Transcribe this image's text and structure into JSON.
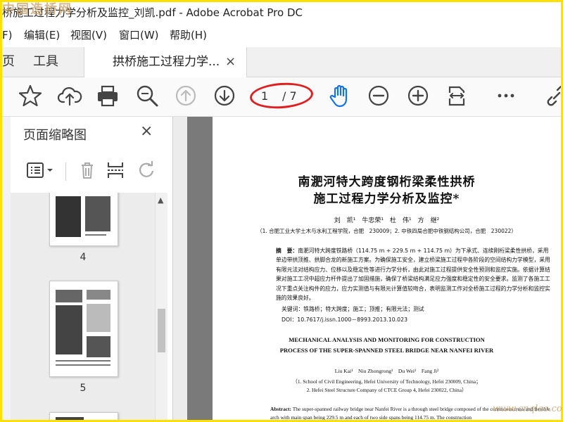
{
  "watermark": {
    "top": "中国造桥网",
    "bottom": "www.cnqlao.com"
  },
  "window": {
    "title": "桥施工过程力学分析及监控_刘凯.pdf - Adobe Acrobat Pro DC"
  },
  "menu": [
    {
      "label": "F)"
    },
    {
      "label": "编辑(E)"
    },
    {
      "label": "视图(V)"
    },
    {
      "label": "窗口(W)"
    },
    {
      "label": "帮助(H)"
    }
  ],
  "tabs": {
    "home_partial": "页",
    "tools": "工具",
    "document": "拱桥施工过程力学...",
    "close": "×"
  },
  "toolbar": {
    "page_current": "1",
    "page_total": "/ 7",
    "icons": [
      "star-icon",
      "cloud-upload-icon",
      "print-icon",
      "zoom-search-icon",
      "page-up-icon",
      "page-down-icon",
      "hand-tool-icon",
      "zoom-out-icon",
      "zoom-in-icon",
      "fit-page-icon",
      "more-icon",
      "link-icon"
    ],
    "accent": "#1473e6",
    "annotation_color": "#e02020"
  },
  "sidebar": {
    "title": "页面缩略图",
    "close": "×",
    "thumbnails": [
      {
        "number": "4"
      },
      {
        "number": "5"
      }
    ]
  },
  "document": {
    "title_line1": "南淝河特大跨度钢桁梁柔性拱桥",
    "title_line2": "施工过程力学分析及监控*",
    "authors": "刘　凯¹　牛忠荣¹　杜　伟¹　方　继²",
    "affiliation": "（1. 合肥工业大学土木与水利工程学院，合肥　230009；2. 中铁四局合肥中铁钢结构公司，合肥　230022）",
    "abstract_label": "摘　要：",
    "abstract_text": "南淝河特大跨度铁路桥（114.75 m + 229.5 m + 114.75 m）为下承式、连续刚桁梁柔性拱桥，采用单边带拱顶推、拱脚合龙的新施工方案。为确保施工安全，建立桥梁施工过程中各阶段的空间结构力学模型，采用有限元法对结构应力、位移以及稳定性等进行力学分析，由此对施工过程提供安全性预测和监控实施。依据计算结果对施工工况中超应力杆件提出了加固措施，确保了桥梁结构满足应力强度和稳定性的安全要求。监测了各施工工况下重点关注构件的应力，应力实测值与有限元计算值较吻合，表明监测工作对全桥施工过程的力学分析和监控实施的效果良好。",
    "keywords": "关键词：铁路桥；特大跨度；施工；顶推；有限元法；测试",
    "doi": "DOI：10.7617/j.issn.1000－8993.2013.10.023",
    "en_title_line1": "MECHANICAL ANALYSIS AND MONITORING FOR CONSTRUCTION",
    "en_title_line2": "PROCESS OF THE SUPER-SPANNED STEEL BRIDGE NEAR NANFEI RIVER",
    "en_authors": "Liu Kai¹　Niu Zhongrong¹　Du Wei¹　Fang Ji²",
    "en_affil1": "（1. School of Civil Engineering, Hefei University of Technology, Hefei 230009, China；",
    "en_affil2": "2. Hefei Steel Structure Company of CTCE Group 4, Hefei 230022, China）",
    "en_abstract_label": "Abstract:",
    "en_abstract_text": "The super-spanned railway bridge near Nanfei River is a through steel bridge composed of the continuous truss and flexible arch with main span being 229.5 m and each of two side spans being 114.75 m. The construction"
  }
}
